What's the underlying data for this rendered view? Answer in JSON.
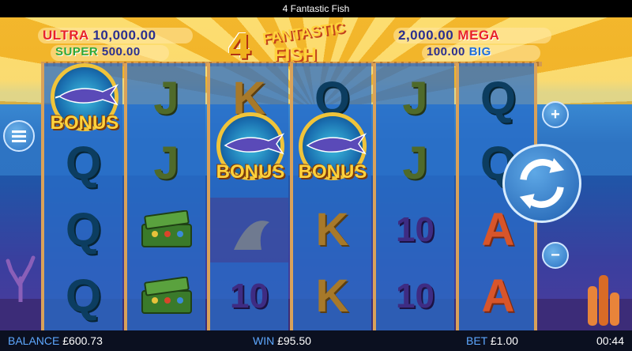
{
  "window": {
    "title": "4 Fantastic Fish"
  },
  "logo": {
    "number": "4",
    "line1": "FANTASTIC",
    "line2": "FISH"
  },
  "jackpots": {
    "ultra": {
      "label": "ULTRA",
      "value": "10,000.00"
    },
    "super": {
      "label": "SUPER",
      "value": "500.00"
    },
    "mega": {
      "label": "MEGA",
      "value": "2,000.00"
    },
    "big": {
      "label": "BIG",
      "value": "100.00"
    }
  },
  "reels": [
    [
      "BONUS",
      "Q",
      "Q",
      "Q"
    ],
    [
      "J",
      "J",
      "tackle-box",
      "tackle-box"
    ],
    [
      "K",
      "BONUS",
      "",
      "10"
    ],
    [
      "Q",
      "BONUS",
      "K",
      "K"
    ],
    [
      "J",
      "J",
      "10",
      "10"
    ],
    [
      "Q",
      "Q",
      "A",
      "A"
    ]
  ],
  "bonus_label": "BONUS",
  "symbols": {
    "q": "Q",
    "j": "J",
    "k": "K",
    "ten": "10",
    "a": "A"
  },
  "controls": {
    "menu_icon": "hamburger-menu-icon",
    "plus_label": "+",
    "minus_label": "−",
    "spin_icon": "spin-arrows-icon"
  },
  "status": {
    "balance_label": "BALANCE",
    "balance_value": "£600.73",
    "win_label": "WIN",
    "win_value": "£95.50",
    "bet_label": "BET",
    "bet_value": "£1.00",
    "clock": "00:44"
  },
  "colors": {
    "accent": "#f0c43a",
    "status_key": "#5ea8ff"
  }
}
